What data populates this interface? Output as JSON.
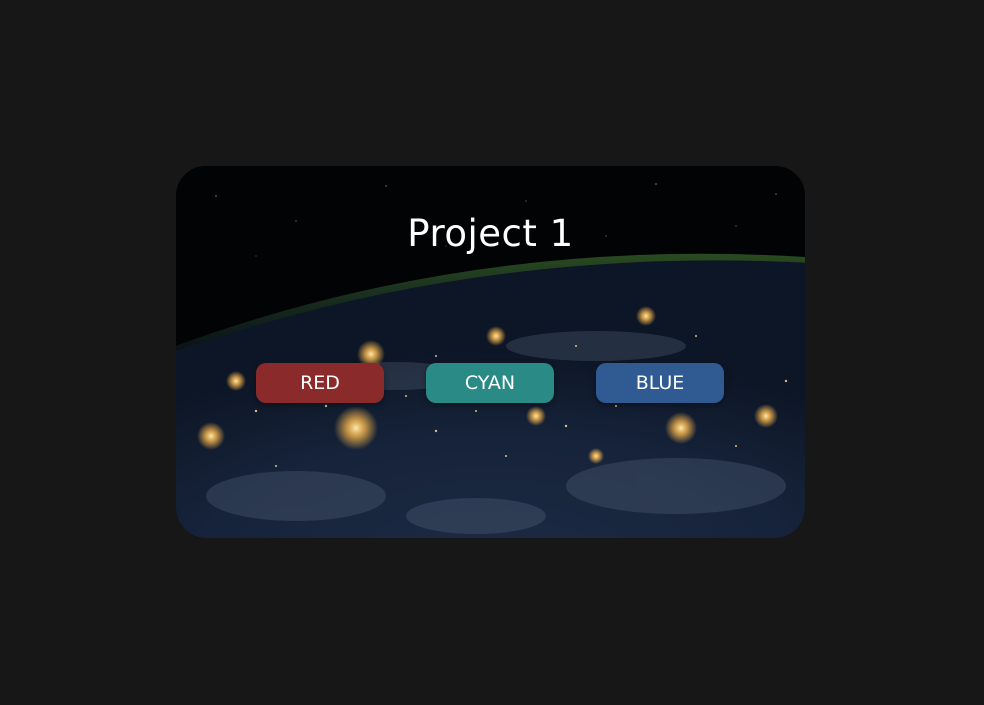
{
  "card": {
    "title": "Project 1",
    "background_image": "earth-at-night-from-space"
  },
  "buttons": [
    {
      "label": "RED",
      "color": "#8b2a2a"
    },
    {
      "label": "CYAN",
      "color": "#2a8a86"
    },
    {
      "label": "BLUE",
      "color": "#2f5a92"
    }
  ]
}
